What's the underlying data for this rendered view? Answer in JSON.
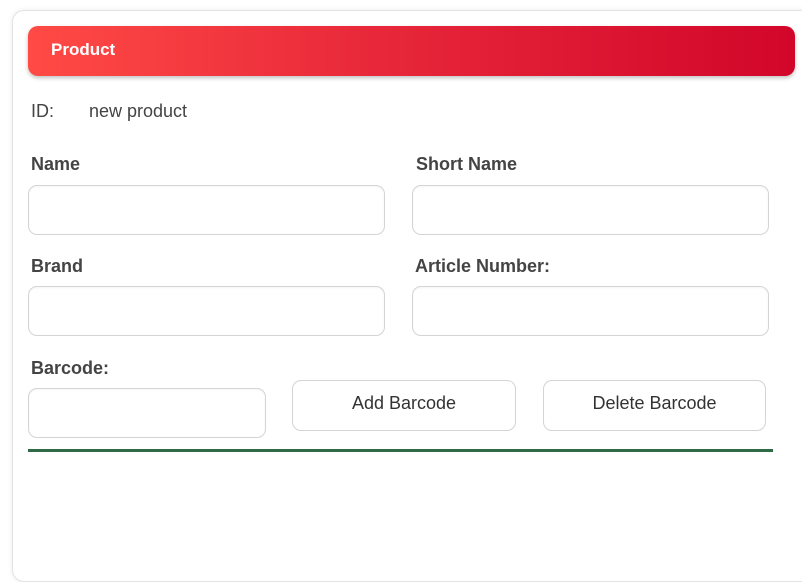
{
  "header": {
    "title": "Product"
  },
  "id_row": {
    "label": "ID:",
    "value": "new product"
  },
  "fields": {
    "name": {
      "label": "Name",
      "value": ""
    },
    "short_name": {
      "label": "Short Name",
      "value": ""
    },
    "brand": {
      "label": "Brand",
      "value": ""
    },
    "article_number": {
      "label": "Article Number:",
      "value": ""
    },
    "barcode": {
      "label": "Barcode:",
      "value": ""
    }
  },
  "buttons": {
    "add_barcode": "Add Barcode",
    "delete_barcode": "Delete Barcode"
  },
  "colors": {
    "header_gradient_start": "#ff4a45",
    "header_gradient_end": "#d2062a",
    "divider": "#2e6b45"
  }
}
